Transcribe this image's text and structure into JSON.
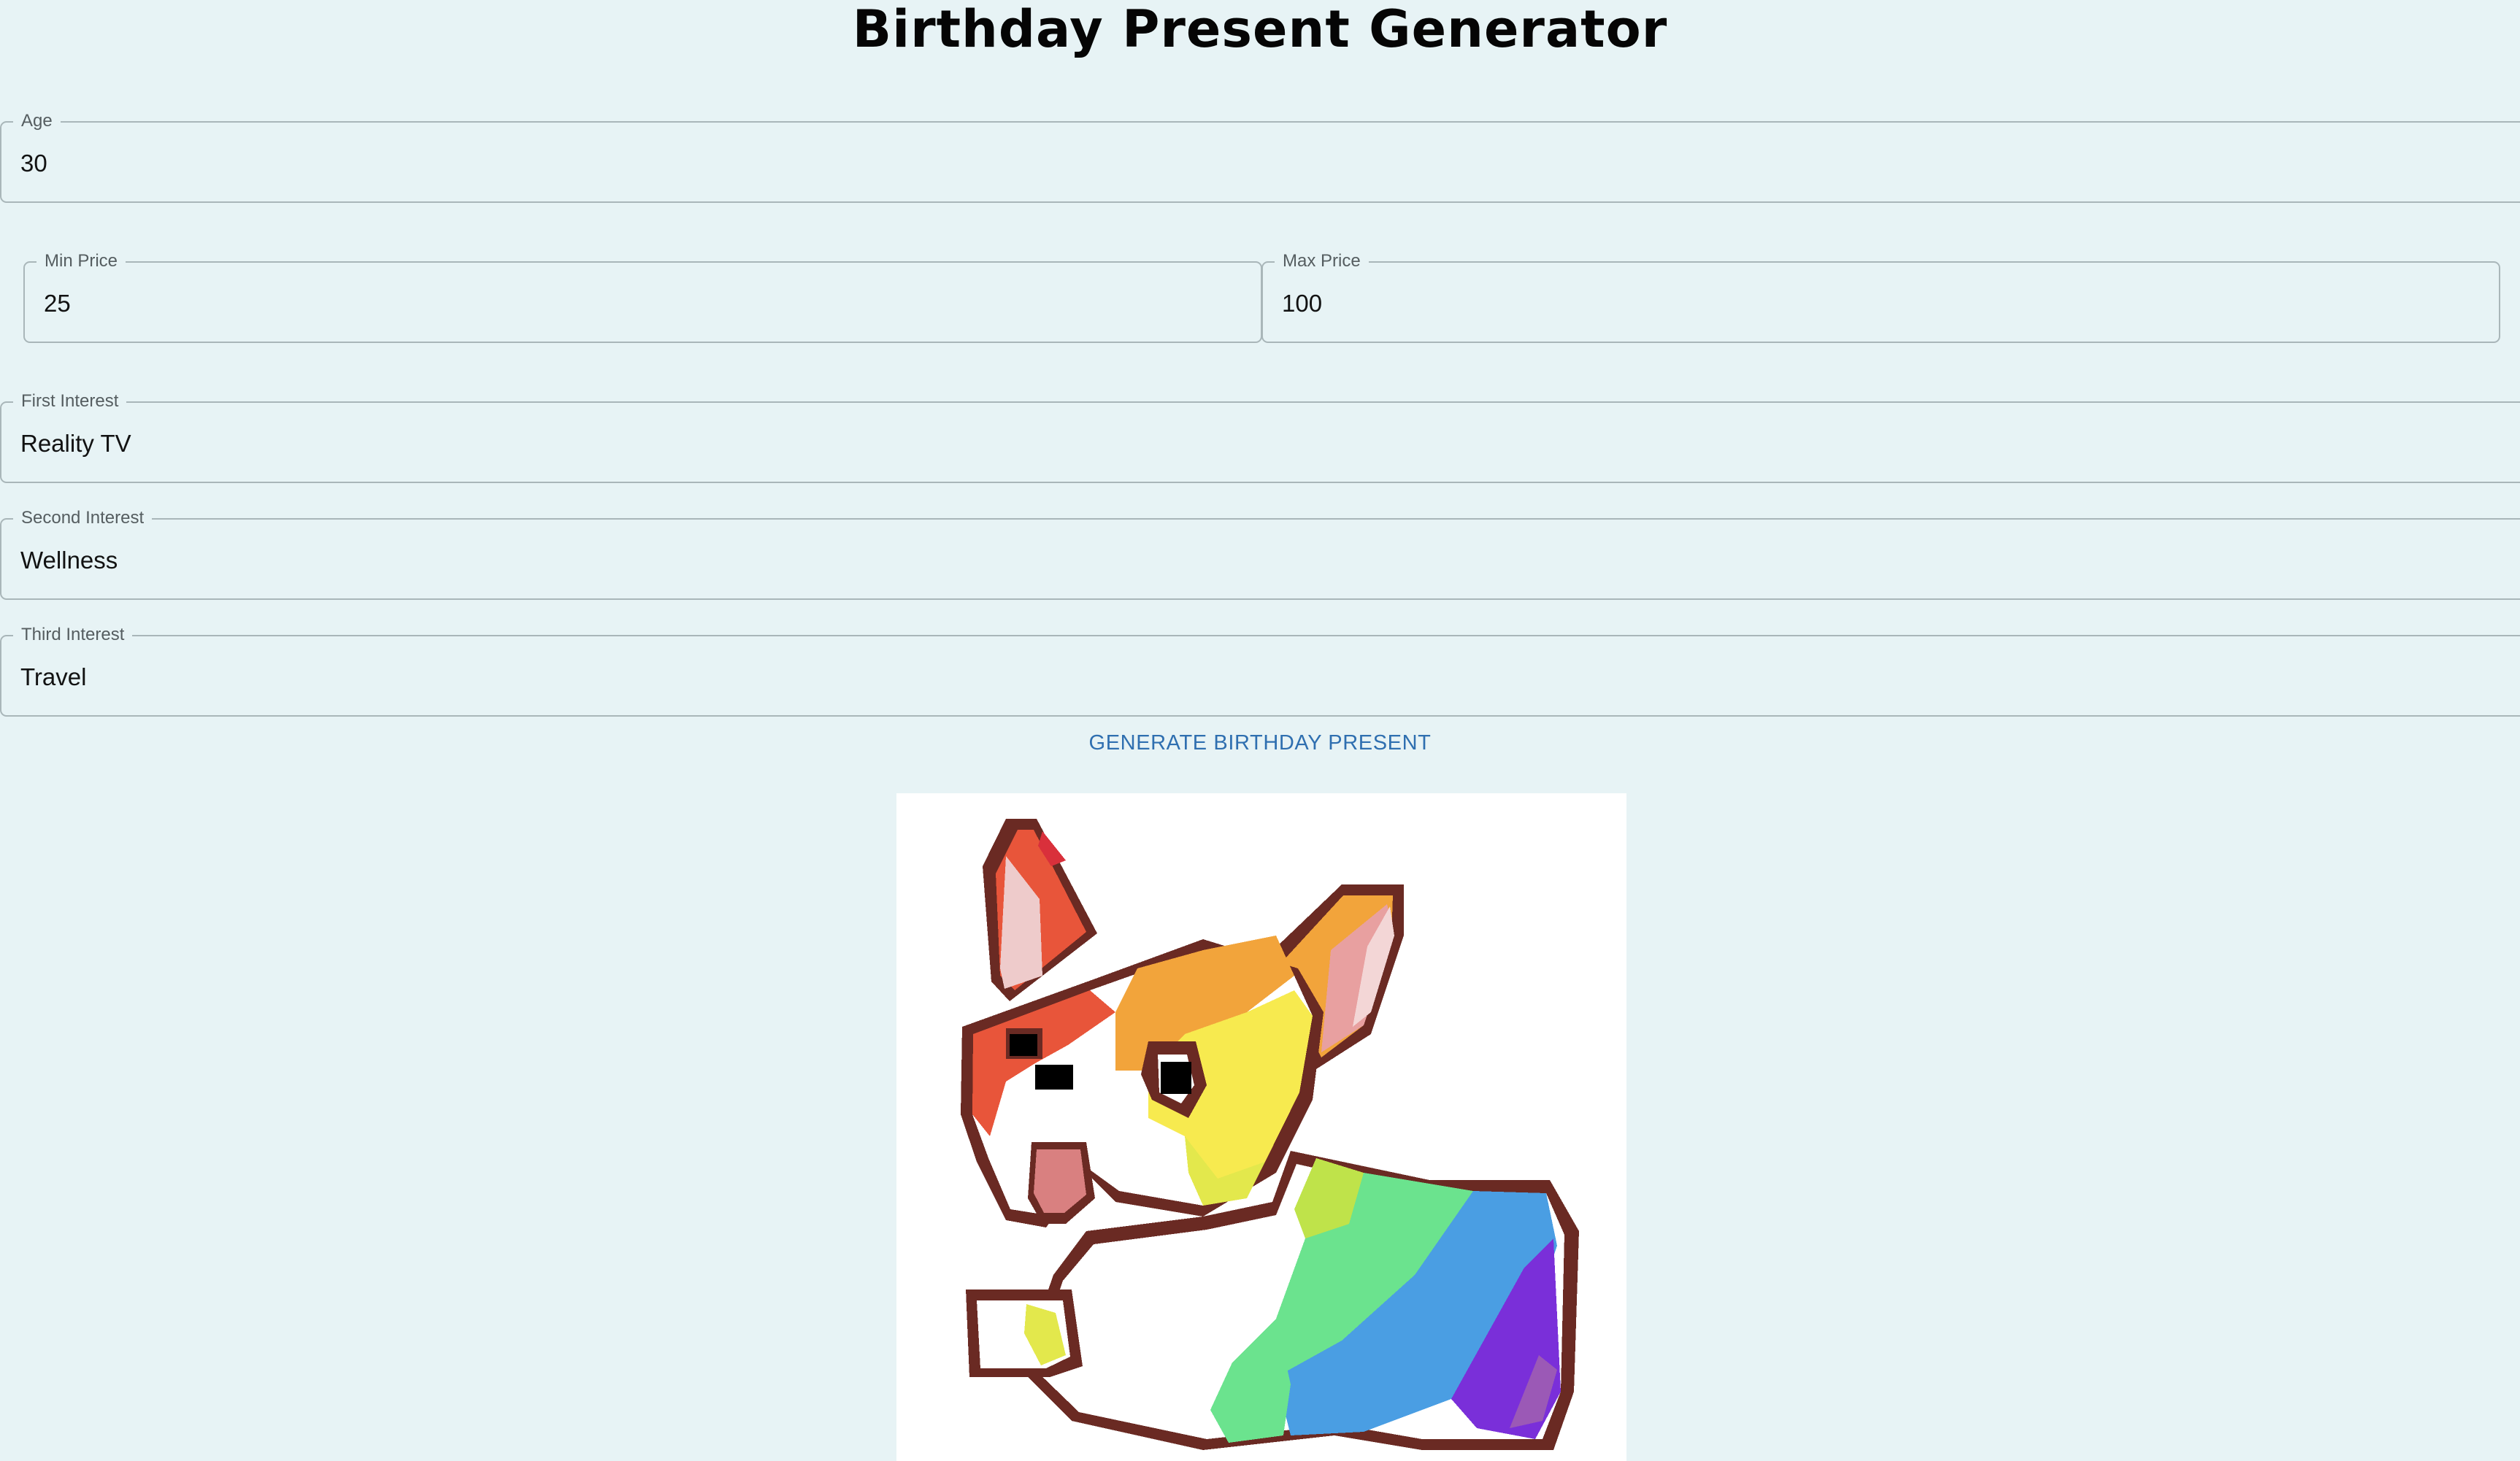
{
  "header": {
    "title": "Birthday Present Generator"
  },
  "form": {
    "age": {
      "label": "Age",
      "value": "30"
    },
    "min_price": {
      "label": "Min Price",
      "value": "25"
    },
    "max_price": {
      "label": "Max Price",
      "value": "100"
    },
    "first_interest": {
      "label": "First Interest",
      "value": "Reality TV"
    },
    "second_interest": {
      "label": "Second Interest",
      "value": "Wellness"
    },
    "third_interest": {
      "label": "Third Interest",
      "value": "Travel"
    },
    "generate_label": "GENERATE BIRTHDAY PRESENT"
  },
  "result": {
    "image_subject": "rainbow-pixel-dog-illustration",
    "colors": {
      "outline": "#6a2a23",
      "red": "#e8553a",
      "orange": "#f2a43b",
      "yellow": "#f7ea4f",
      "green": "#6be38e",
      "blue": "#4a9ee3",
      "purple": "#7a2fd9",
      "pink": "#e8a0a0"
    }
  }
}
